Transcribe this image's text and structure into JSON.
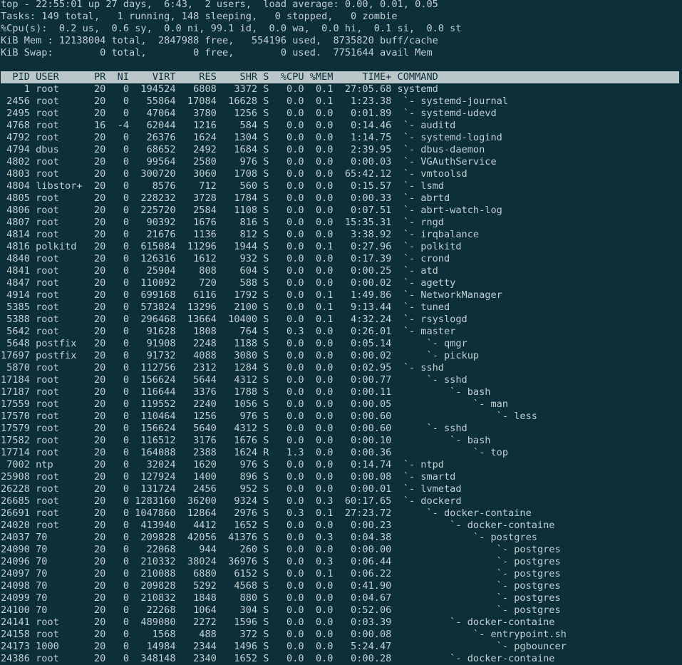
{
  "summary": [
    "top - 22:55:01 up 27 days,  6:43,  2 users,  load average: 0.00, 0.01, 0.05",
    "Tasks: 149 total,   1 running, 148 sleeping,   0 stopped,   0 zombie",
    "%Cpu(s):  0.2 us,  0.6 sy,  0.0 ni, 99.1 id,  0.0 wa,  0.0 hi,  0.1 si,  0.0 st",
    "KiB Mem : 12138004 total,  2847988 free,   554196 used,  8735820 buff/cache",
    "KiB Swap:        0 total,        0 free,        0 used.  7751644 avail Mem"
  ],
  "header": "  PID USER      PR  NI    VIRT    RES    SHR S  %CPU %MEM     TIME+ COMMAND",
  "processes": [
    "    1 root      20   0  194524   6808   3372 S   0.0  0.1  27:05.68 systemd",
    " 2456 root      20   0   55864  17084  16628 S   0.0  0.1   1:23.38  `- systemd-journal",
    " 2495 root      20   0   47064   3780   1256 S   0.0  0.0   0:01.89  `- systemd-udevd",
    " 4768 root      16  -4   62044   1216    584 S   0.0  0.0   0:14.46  `- auditd",
    " 4792 root      20   0   26376   1624   1304 S   0.0  0.0   1:14.75  `- systemd-logind",
    " 4794 dbus      20   0   68652   2492   1684 S   0.0  0.0   2:39.95  `- dbus-daemon",
    " 4802 root      20   0   99564   2580    976 S   0.0  0.0   0:00.03  `- VGAuthService",
    " 4803 root      20   0  300720   3060   1708 S   0.0  0.0  65:42.12  `- vmtoolsd",
    " 4804 libstor+  20   0    8576    712    560 S   0.0  0.0   0:15.57  `- lsmd",
    " 4805 root      20   0  228232   3728   1784 S   0.0  0.0   0:00.33  `- abrtd",
    " 4806 root      20   0  225720   2584   1108 S   0.0  0.0   0:07.51  `- abrt-watch-log",
    " 4807 root      20   0   90392   1676    816 S   0.0  0.0  15:35.31  `- rngd",
    " 4814 root      20   0   21676   1136    812 S   0.0  0.0   3:38.92  `- irqbalance",
    " 4816 polkitd   20   0  615084  11296   1944 S   0.0  0.1   0:27.96  `- polkitd",
    " 4840 root      20   0  126316   1612    932 S   0.0  0.0   0:17.39  `- crond",
    " 4841 root      20   0   25904    808    604 S   0.0  0.0   0:00.25  `- atd",
    " 4847 root      20   0  110092    720    588 S   0.0  0.0   0:00.02  `- agetty",
    " 4914 root      20   0  699168   6116   1792 S   0.0  0.1   1:49.86  `- NetworkManager",
    " 5385 root      20   0  573824  13296   2100 S   0.0  0.1   9:13.44  `- tuned",
    " 5388 root      20   0  296468  13664  10400 S   0.0  0.1   4:32.24  `- rsyslogd",
    " 5642 root      20   0   91628   1808    764 S   0.3  0.0   0:26.01  `- master",
    " 5648 postfix   20   0   91908   2248   1188 S   0.0  0.0   0:05.14      `- qmgr",
    "17697 postfix   20   0   91732   4088   3080 S   0.0  0.0   0:00.02      `- pickup",
    " 5870 root      20   0  112756   2312   1284 S   0.0  0.0   0:02.95  `- sshd",
    "17184 root      20   0  156624   5644   4312 S   0.0  0.0   0:00.77      `- sshd",
    "17187 root      20   0  116644   3376   1788 S   0.0  0.0   0:00.11          `- bash",
    "17559 root      20   0  119552   2240   1056 S   0.0  0.0   0:00.05              `- man",
    "17570 root      20   0  110464   1256    976 S   0.0  0.0   0:00.60                  `- less",
    "17579 root      20   0  156624   5640   4312 S   0.0  0.0   0:00.60      `- sshd",
    "17582 root      20   0  116512   3176   1676 S   0.0  0.0   0:00.10          `- bash",
    "17714 root      20   0  164088   2388   1624 R   1.3  0.0   0:00.36              `- top",
    " 7002 ntp       20   0   32024   1620    976 S   0.0  0.0   0:14.74  `- ntpd",
    "25908 root      20   0  127924   1400    896 S   0.0  0.0   0:00.08  `- smartd",
    "26228 root      20   0  131724   2456    952 S   0.0  0.0   0:00.01  `- lvmetad",
    "26685 root      20   0 1283160  36200   9324 S   0.0  0.3  60:17.65  `- dockerd",
    "26691 root      20   0 1047860  12864   2976 S   0.3  0.1  27:23.72      `- docker-containe",
    "24020 root      20   0  413940   4412   1652 S   0.0  0.0   0:00.23          `- docker-containe",
    "24037 70        20   0  209828  42056  41376 S   0.0  0.3   0:04.38              `- postgres",
    "24090 70        20   0   22068    944    260 S   0.0  0.0   0:00.00                  `- postgres",
    "24096 70        20   0  210332  38024  36976 S   0.0  0.3   0:06.44                  `- postgres",
    "24097 70        20   0  210088   6880   6152 S   0.0  0.1   0:06.22                  `- postgres",
    "24098 70        20   0  209828   5292   4568 S   0.0  0.0   0:41.90                  `- postgres",
    "24099 70        20   0  210832   1848    880 S   0.0  0.0   0:04.67                  `- postgres",
    "24100 70        20   0   22268   1064    304 S   0.0  0.0   0:52.06                  `- postgres",
    "24141 root      20   0  489080   2272   1596 S   0.0  0.0   0:03.39          `- docker-containe",
    "24158 root      20   0    1568    488    372 S   0.0  0.0   0:00.08              `- entrypoint.sh",
    "24173 1000      20   0   14984   2344   1496 S   0.0  0.0   5:24.47                  `- pgbouncer",
    "24386 root      20   0  348148   2340   1652 S   0.0  0.0   0:00.28          `- docker-containe"
  ]
}
